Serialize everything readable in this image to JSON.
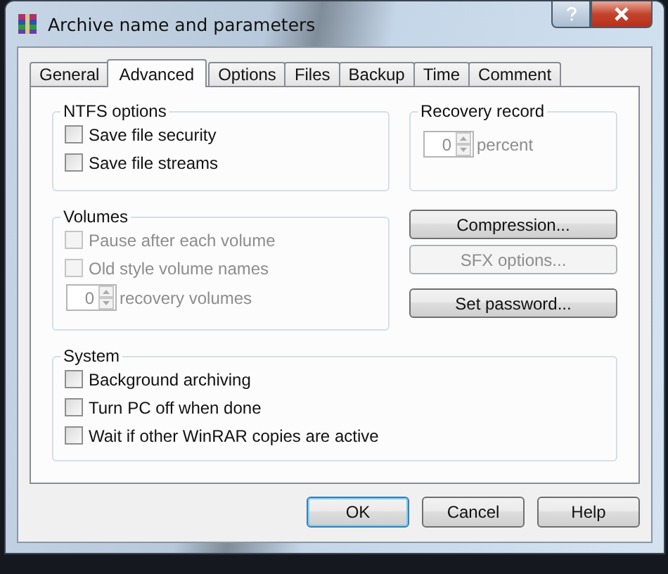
{
  "window": {
    "title": "Archive name and parameters"
  },
  "tabs": [
    {
      "label": "General",
      "selected": false
    },
    {
      "label": "Advanced",
      "selected": true
    },
    {
      "label": "Options",
      "selected": false
    },
    {
      "label": "Files",
      "selected": false
    },
    {
      "label": "Backup",
      "selected": false
    },
    {
      "label": "Time",
      "selected": false
    },
    {
      "label": "Comment",
      "selected": false
    }
  ],
  "ntfs_options": {
    "title": "NTFS options",
    "options": [
      {
        "label": "Save file security",
        "checked": false,
        "disabled": false
      },
      {
        "label": "Save file streams",
        "checked": false,
        "disabled": false
      }
    ]
  },
  "recovery_record": {
    "title": "Recovery record",
    "value": "0",
    "unit": "percent",
    "disabled": true
  },
  "volumes": {
    "title": "Volumes",
    "options": [
      {
        "label": "Pause after each volume",
        "checked": false,
        "disabled": true
      },
      {
        "label": "Old style volume names",
        "checked": false,
        "disabled": true
      }
    ],
    "spinner": {
      "value": "0",
      "unit": "recovery volumes",
      "disabled": true
    }
  },
  "side_buttons": [
    {
      "label": "Compression...",
      "disabled": false
    },
    {
      "label": "SFX options...",
      "disabled": true
    },
    {
      "label": "Set password...",
      "disabled": false
    }
  ],
  "system": {
    "title": "System",
    "options": [
      {
        "label": "Background archiving",
        "checked": false,
        "disabled": false
      },
      {
        "label": "Turn PC off when done",
        "checked": false,
        "disabled": false
      },
      {
        "label": "Wait if other WinRAR copies are active",
        "checked": false,
        "disabled": false
      }
    ]
  },
  "buttons": [
    {
      "label": "OK",
      "default": true
    },
    {
      "label": "Cancel",
      "default": false
    },
    {
      "label": "Help",
      "default": false
    }
  ]
}
